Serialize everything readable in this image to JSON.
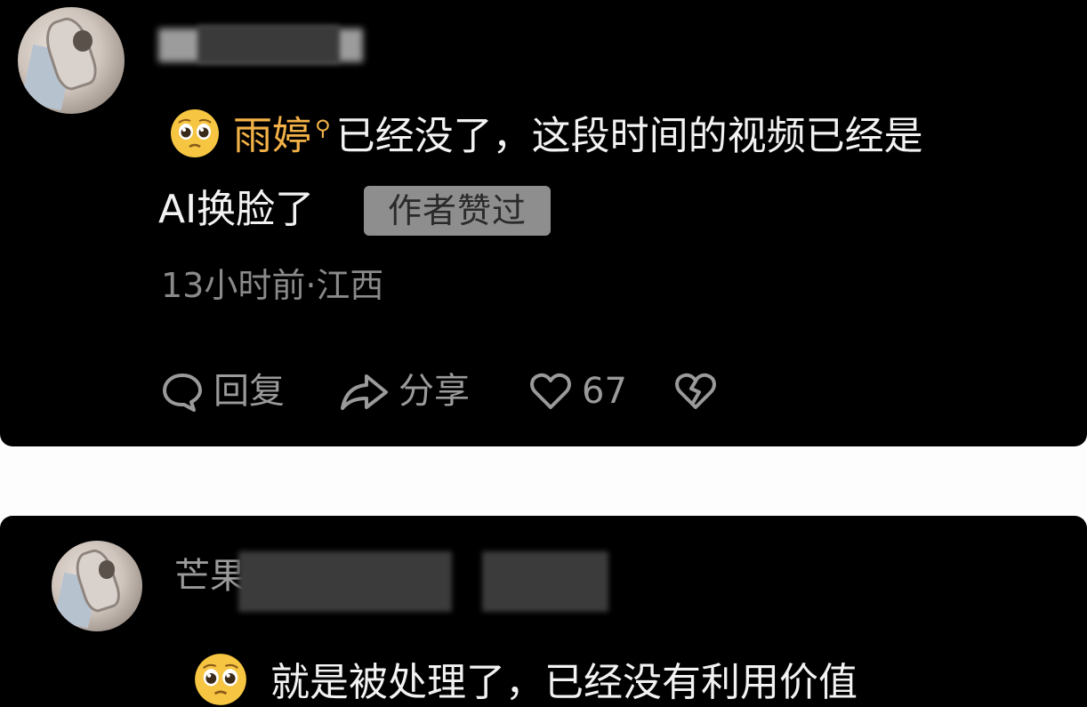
{
  "comment1": {
    "reply_target": "雨婷",
    "text_line1": "已经没了，这段时间的视频已经是",
    "text_line2": "AI换脸了",
    "badge": "作者赞过",
    "meta": "13小时前·江西",
    "actions": {
      "reply": "回复",
      "share": "分享",
      "like_count": "67"
    },
    "emoji": "pleading-face"
  },
  "comment2": {
    "username_visible": "芒果",
    "text": "就是被处理了，已经没有利用价值",
    "emoji": "pleading-face"
  },
  "colors": {
    "background": "#000000",
    "mention": "#f3b247",
    "text": "#f2f2f2",
    "meta": "#8a8a8a",
    "badge_bg": "#8e8e8e"
  }
}
